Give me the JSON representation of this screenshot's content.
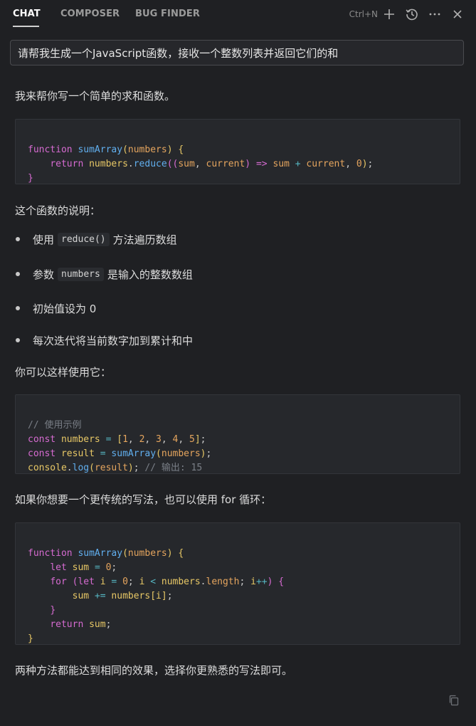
{
  "header": {
    "tabs": [
      {
        "label": "CHAT",
        "active": true
      },
      {
        "label": "COMPOSER",
        "active": false
      },
      {
        "label": "BUG FINDER",
        "active": false
      }
    ],
    "shortcut": "Ctrl+N",
    "icons": [
      "plus-icon",
      "history-icon",
      "more-icon",
      "close-icon"
    ]
  },
  "prompt": "请帮我生成一个JavaScript函数，接收一个整数列表并返回它们的和",
  "response": {
    "intro": "我来帮你写一个简单的求和函数。",
    "code1": [
      "function sumArray(numbers) {",
      "    return numbers.reduce((sum, current) => sum + current, 0);",
      "}"
    ],
    "explain_heading": "这个函数的说明：",
    "bullets": [
      {
        "pre": "使用",
        "code": "reduce()",
        "post": "方法遍历数组"
      },
      {
        "pre": "参数",
        "code": "numbers",
        "post": "是输入的整数数组"
      },
      {
        "pre": "初始值设为 0",
        "code": "",
        "post": ""
      },
      {
        "pre": "每次迭代将当前数字加到累计和中",
        "code": "",
        "post": ""
      }
    ],
    "usage_heading": "你可以这样使用它：",
    "code2": [
      "// 使用示例",
      "const numbers = [1, 2, 3, 4, 5];",
      "const result = sumArray(numbers);",
      "console.log(result); // 输出: 15"
    ],
    "alt_heading": "如果你想要一个更传统的写法，也可以使用 for 循环：",
    "code3": [
      "function sumArray(numbers) {",
      "    let sum = 0;",
      "    for (let i = 0; i < numbers.length; i++) {",
      "        sum += numbers[i];",
      "    }",
      "    return sum;",
      "}"
    ],
    "conclusion": "两种方法都能达到相同的效果，选择你更熟悉的写法即可。"
  },
  "colors": {
    "background": "#1f2023",
    "code_background": "#26282c",
    "keyword": "#d66bd1",
    "function": "#61afef",
    "variable": "#e8c866",
    "number": "#e5a55e",
    "operator": "#56b6c2",
    "comment": "#7a7f87"
  }
}
